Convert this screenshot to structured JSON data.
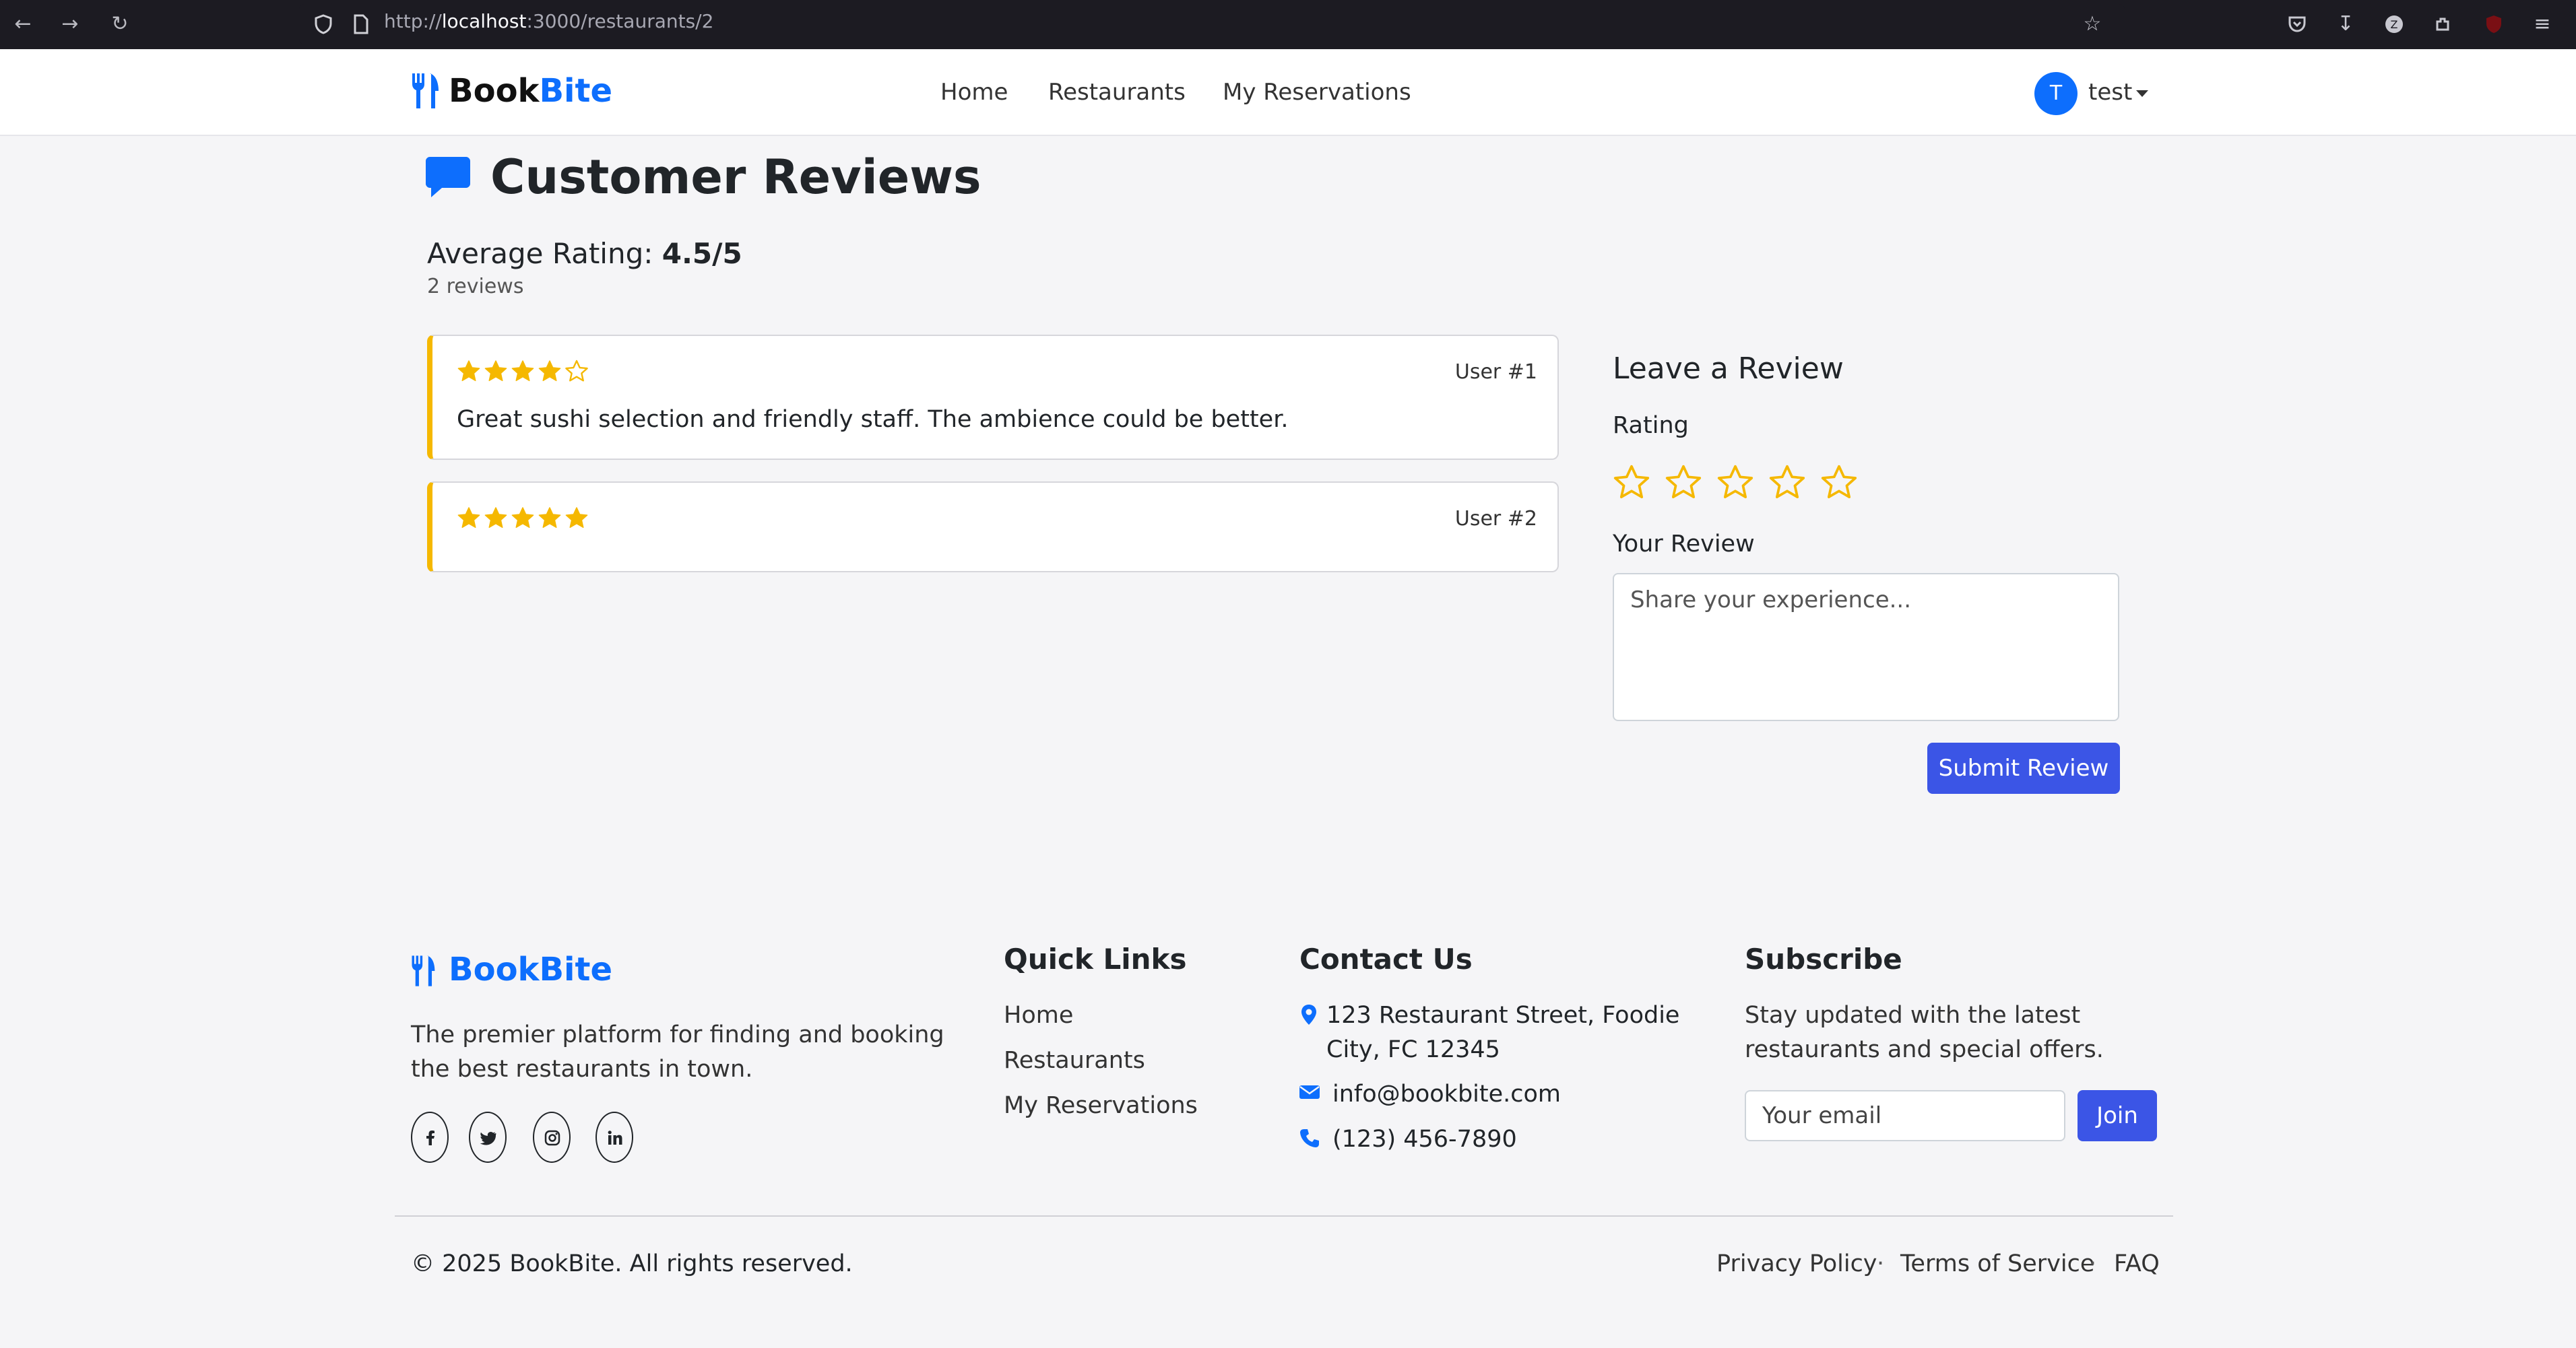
{
  "browser": {
    "url_prefix": "http://",
    "url_host": "localhost",
    "url_path": ":3000/restaurants/2"
  },
  "navbar": {
    "brand_part1": "Book",
    "brand_part2": "Bite",
    "links": [
      "Home",
      "Restaurants",
      "My Reservations"
    ],
    "avatar_initial": "T",
    "username": "test"
  },
  "reviews_section": {
    "title": "Customer Reviews",
    "avg_label": "Average Rating:",
    "avg_value": "4.5/5",
    "count_text": "2 reviews",
    "reviews": [
      {
        "rating": 4,
        "user": "User #1",
        "text": "Great sushi selection and friendly staff. The ambience could be better."
      },
      {
        "rating": 5,
        "user": "User #2",
        "text": ""
      }
    ]
  },
  "review_form": {
    "title": "Leave a Review",
    "rating_label": "Rating",
    "rating_value": 0,
    "rating_max": 5,
    "review_label": "Your Review",
    "review_placeholder": "Share your experience...",
    "review_value": "",
    "submit_label": "Submit Review"
  },
  "footer": {
    "brand_part1": "Book",
    "brand_part2": "Bite",
    "tagline": "The premier platform for finding and booking the best restaurants in town.",
    "social_icons": [
      "facebook-icon",
      "twitter-icon",
      "instagram-icon",
      "linkedin-icon"
    ],
    "quick_links_title": "Quick Links",
    "quick_links": [
      "Home",
      "Restaurants",
      "My Reservations"
    ],
    "contact_title": "Contact Us",
    "address": "123 Restaurant Street, Foodie City, FC 12345",
    "email": "info@bookbite.com",
    "phone": "(123) 456-7890",
    "subscribe_title": "Subscribe",
    "subscribe_text": "Stay updated with the latest restaurants and special offers.",
    "email_placeholder": "Your email",
    "join_label": "Join",
    "copyright": "© 2025 BookBite. All rights reserved.",
    "legal_links": [
      "Privacy Policy",
      "Terms of Service",
      "FAQ"
    ],
    "legal_separator": "·"
  },
  "colors": {
    "brand_blue": "#0d6efd",
    "button_blue": "#3b55e6",
    "star_gold": "#f5b800"
  }
}
